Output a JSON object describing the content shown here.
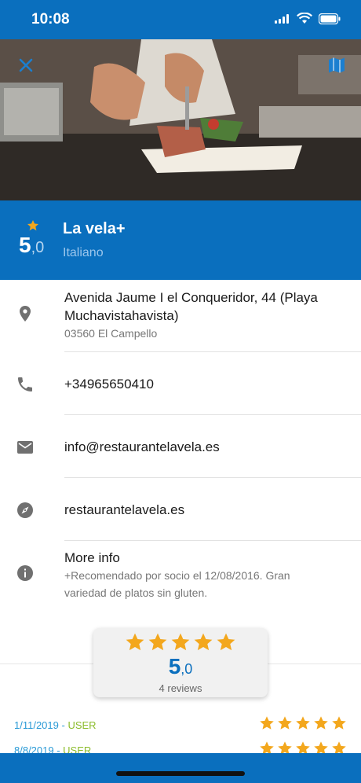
{
  "status": {
    "time": "10:08"
  },
  "hero": {
    "close_icon": "close-icon",
    "map_icon": "map-icon"
  },
  "header": {
    "score_int": "5",
    "score_dec": ",0",
    "name": "La vela+",
    "cuisine": "Italiano"
  },
  "details": {
    "address_line1": "Avenida Jaume I el Conqueridor, 44 (Playa",
    "address_line2": "Muchavistahavista)",
    "postal": "03560 El Campello",
    "phone": "+34965650410",
    "email": "info@restaurantelavela.es",
    "website": "restaurantelavela.es",
    "more_info_title": "More info",
    "more_info_line1": "+Recomendado por socio el 12/08/2016. Gran",
    "more_info_line2": "variedad de platos sin gluten."
  },
  "rating_summary": {
    "stars": 5,
    "score_int": "5",
    "score_dec": ",0",
    "count": "4 reviews"
  },
  "reviews": [
    {
      "date": "1/11/2019",
      "separator": " - ",
      "user": "USER",
      "stars": 5
    },
    {
      "date": "8/8/2019",
      "separator": " - ",
      "user": "USER",
      "stars": 5
    }
  ],
  "colors": {
    "brand": "#0a6fbe",
    "star": "#f3a71d",
    "date": "#2a9ad6",
    "user": "#8cbc2c"
  }
}
